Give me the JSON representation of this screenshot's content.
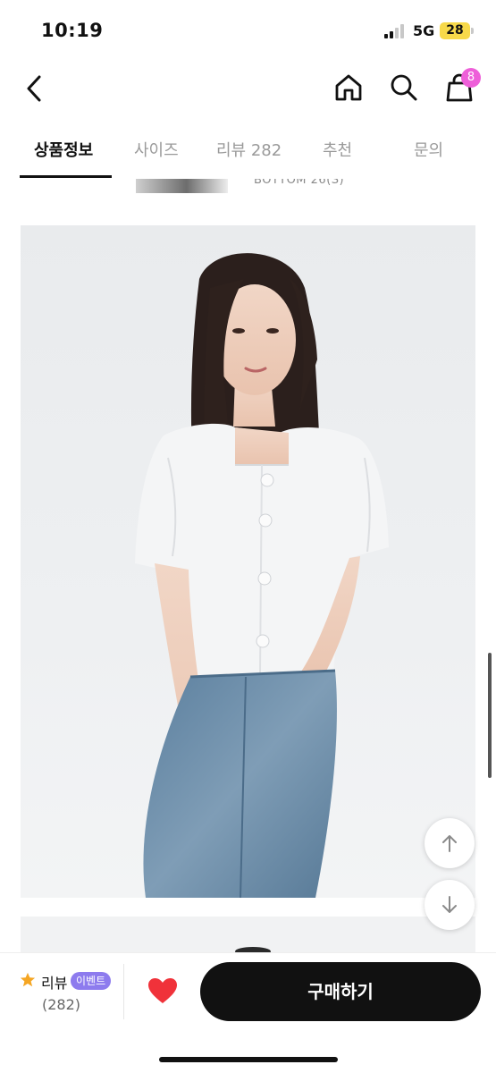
{
  "status_bar": {
    "time": "10:19",
    "network": "5G",
    "battery": "28"
  },
  "header": {
    "cart_count": "8"
  },
  "tabs": [
    {
      "label": "상품정보",
      "active": true
    },
    {
      "label": "사이즈",
      "active": false
    },
    {
      "label": "리뷰 282",
      "active": false
    },
    {
      "label": "추천",
      "active": false
    },
    {
      "label": "문의",
      "active": false
    }
  ],
  "previous_section": {
    "text": "BOTTOM  26(S)"
  },
  "product_image": {
    "subject": "model-white-square-neck-blouse-with-jeans"
  },
  "float_buttons": {
    "up_icon": "arrow-up-icon",
    "down_icon": "arrow-down-icon"
  },
  "bottom_bar": {
    "review_label": "리뷰",
    "event_badge": "이벤트",
    "review_count": "(282)",
    "buy_label": "구매하기"
  },
  "colors": {
    "accent_pink": "#ee5fd9",
    "event_purple": "#8d7bee",
    "heart_red": "#f0323a",
    "buy_bg": "#111111"
  }
}
